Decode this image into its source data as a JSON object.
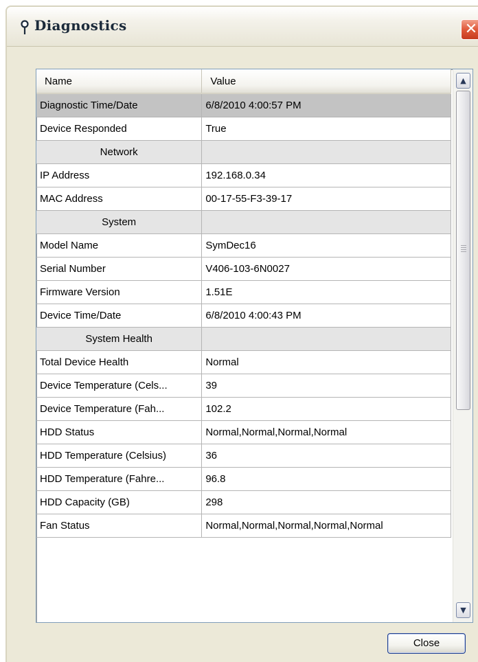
{
  "window": {
    "title": "Diagnostics",
    "close_glyph": "✕",
    "title_icon": "pin-icon"
  },
  "grid": {
    "columns": [
      "Name",
      "Value"
    ],
    "rows": [
      {
        "name": "Diagnostic Time/Date",
        "value": "6/8/2010 4:00:57 PM",
        "kind": "selected"
      },
      {
        "name": "Device Responded",
        "value": "True",
        "kind": "normal"
      },
      {
        "name": "Network",
        "value": "",
        "kind": "section"
      },
      {
        "name": "IP Address",
        "value": "192.168.0.34",
        "kind": "normal"
      },
      {
        "name": "MAC Address",
        "value": "00-17-55-F3-39-17",
        "kind": "normal"
      },
      {
        "name": "System",
        "value": "",
        "kind": "section"
      },
      {
        "name": "Model Name",
        "value": "SymDec16",
        "kind": "normal"
      },
      {
        "name": "Serial Number",
        "value": "V406-103-6N0027",
        "kind": "normal"
      },
      {
        "name": "Firmware Version",
        "value": "1.51E",
        "kind": "normal"
      },
      {
        "name": "Device Time/Date",
        "value": "6/8/2010 4:00:43 PM",
        "kind": "normal"
      },
      {
        "name": "System Health",
        "value": "",
        "kind": "section"
      },
      {
        "name": "Total Device Health",
        "value": "Normal",
        "kind": "normal"
      },
      {
        "name": "Device Temperature (Cels...",
        "value": "39",
        "kind": "normal"
      },
      {
        "name": "Device Temperature (Fah...",
        "value": "102.2",
        "kind": "normal"
      },
      {
        "name": "HDD Status",
        "value": "Normal,Normal,Normal,Normal",
        "kind": "normal"
      },
      {
        "name": "HDD Temperature (Celsius)",
        "value": "36",
        "kind": "normal"
      },
      {
        "name": "HDD Temperature (Fahre...",
        "value": "96.8",
        "kind": "normal"
      },
      {
        "name": "HDD Capacity (GB)",
        "value": "298",
        "kind": "normal"
      },
      {
        "name": "Fan Status",
        "value": "Normal,Normal,Normal,Normal,Normal",
        "kind": "normal"
      }
    ]
  },
  "scrollbar": {
    "up_glyph": "▲",
    "down_glyph": "▼"
  },
  "footer": {
    "close_label": "Close"
  }
}
